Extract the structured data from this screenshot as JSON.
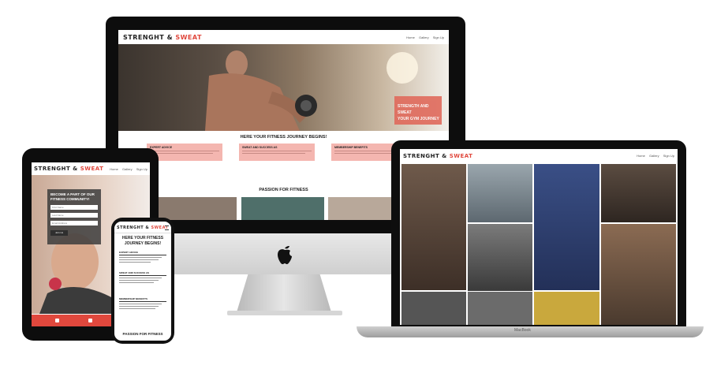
{
  "brand": {
    "name": "STRENGHT",
    "amp": "&",
    "accent_word": "SWEAT",
    "accent_color": "#e0483d"
  },
  "nav": {
    "home": "Home",
    "gallery": "Gallery",
    "signup": "Sign Up"
  },
  "hero": {
    "badge_line1": "STRENGTH AND SWEAT",
    "badge_line2": "YOUR GYM JOURNEY"
  },
  "journey_title": "HERE YOUR FITNESS JOURNEY BEGINS!",
  "cards": [
    {
      "title": "EXPERT ADVICE",
      "icon": "bookmark-icon"
    },
    {
      "title": "SWEAT AND SUCCESS AS",
      "icon": "heart-icon"
    },
    {
      "title": "MEMBERSHIP BENEFITS",
      "icon": "star-icon"
    }
  ],
  "passion_title": "PASSION FOR FITNESS",
  "signup": {
    "heading": "BECOME A PART OF OUR FITNESS COMMUNITY!",
    "first_name": "First Name",
    "last_name": "Last Name",
    "email": "Email Address",
    "submit": "Join Us"
  },
  "phone": {
    "journey_title": "HERE YOUR FITNESS JOURNEY BEGINS!"
  },
  "macbook_label": "MacBook",
  "colors": {
    "card_bg": "#f4b6b0",
    "hero_badge": "#e06a5c",
    "device_bezel": "#0d0d0d"
  }
}
